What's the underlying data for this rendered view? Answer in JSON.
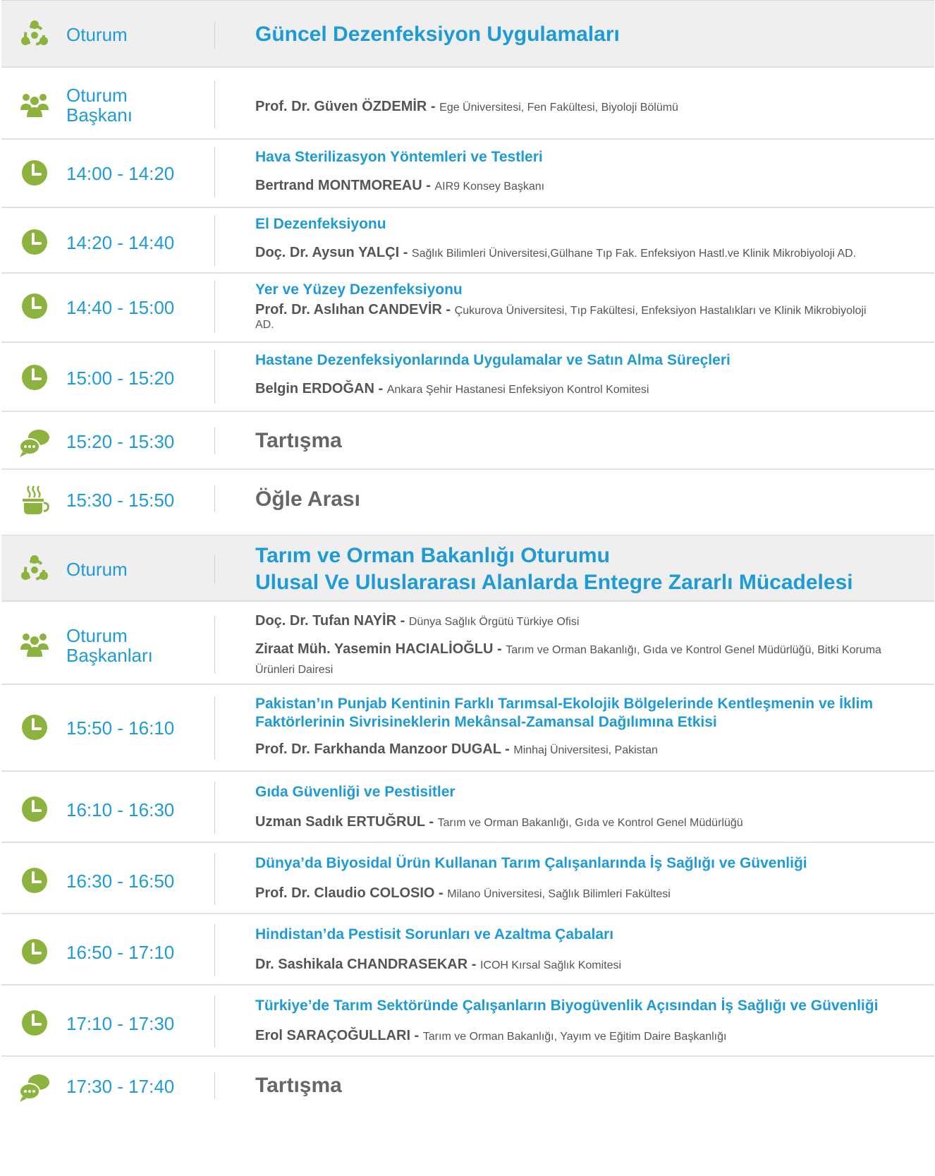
{
  "colors": {
    "accent_blue": "#1e9bd7",
    "icon_green": "#8cb33e",
    "text_gray": "#555555",
    "session_bg": "#efefef"
  },
  "session1": {
    "label": "Oturum",
    "title": "Güncel Dezenfeksiyon Uygulamaları",
    "icon": "session-network-icon"
  },
  "chair1": {
    "label_line1": "Oturum",
    "label_line2": "Başkanı",
    "name": "Prof. Dr. Güven ÖZDEMİR",
    "sep": " - ",
    "aff": "Ege Üniversitesi, Fen Fakültesi, Biyoloji Bölümü",
    "icon": "people-icon"
  },
  "talks1": [
    {
      "time": "14:00 - 14:20",
      "title": "Hava Sterilizasyon Yöntemleri ve Testleri",
      "name": "Bertrand MONTMOREAU",
      "sep": " - ",
      "aff": "AIR9 Konsey Başkanı"
    },
    {
      "time": "14:20 - 14:40",
      "title": "El Dezenfeksiyonu",
      "name": "Doç. Dr. Aysun YALÇI",
      "sep": " - ",
      "aff": "Sağlık Bilimleri Üniversitesi,Gülhane Tıp Fak. Enfeksiyon Hastl.ve Klinik Mikrobiyoloji AD."
    },
    {
      "time": "14:40 - 15:00",
      "title": "Yer ve Yüzey Dezenfeksiyonu",
      "name": "Prof. Dr. Aslıhan CANDEVİR",
      "sep": " - ",
      "aff": "Çukurova Üniversitesi, Tıp Fakültesi, Enfeksiyon Hastalıkları ve Klinik Mikrobiyoloji AD."
    },
    {
      "time": "15:00 - 15:20",
      "title": "Hastane Dezenfeksiyonlarında Uygulamalar ve Satın Alma Süreçleri",
      "name": "Belgin ERDOĞAN",
      "sep": " - ",
      "aff": "Ankara Şehir Hastanesi Enfeksiyon Kontrol Komitesi"
    }
  ],
  "discussion1": {
    "time": "15:20 - 15:30",
    "title": "Tartışma",
    "icon": "chat-bubble-icon"
  },
  "break1": {
    "time": "15:30 - 15:50",
    "title": "Öğle Arası",
    "icon": "coffee-cup-icon"
  },
  "session2": {
    "label": "Oturum",
    "title_line1": "Tarım ve Orman Bakanlığı Oturumu",
    "title_line2": "Ulusal Ve Uluslararası Alanlarda Entegre Zararlı Mücadelesi",
    "icon": "session-network-icon"
  },
  "chair2": {
    "label_line1": "Oturum",
    "label_line2": "Başkanları",
    "chairs": [
      {
        "name": "Doç. Dr. Tufan NAYİR",
        "sep": " - ",
        "aff": "Dünya Sağlık Örgütü Türkiye Ofisi"
      },
      {
        "name": "Ziraat Müh. Yasemin HACIALİOĞLU",
        "sep": "  - ",
        "aff": "Tarım ve Orman Bakanlığı, Gıda ve Kontrol Genel Müdürlüğü, Bitki Koruma Ürünleri Dairesi"
      }
    ],
    "icon": "people-icon"
  },
  "talks2": [
    {
      "time": "15:50 - 16:10",
      "title": "Pakistan’ın Punjab Kentinin Farklı Tarımsal-Ekolojik Bölgelerinde Kentleşmenin ve İklim Faktörlerinin Sivrisineklerin Mekânsal-Zamansal Dağılımına Etkisi",
      "name": "Prof. Dr. Farkhanda Manzoor DUGAL",
      "sep": " - ",
      "aff": "Minhaj Üniversitesi, Pakistan"
    },
    {
      "time": "16:10 - 16:30",
      "title": "Gıda Güvenliği ve Pestisitler",
      "name": "Uzman Sadık ERTUĞRUL",
      "sep": " - ",
      "aff": "Tarım ve Orman Bakanlığı, Gıda ve Kontrol Genel Müdürlüğü"
    },
    {
      "time": "16:30 - 16:50",
      "title": "Dünya’da Biyosidal Ürün Kullanan Tarım Çalışanlarında İş Sağlığı ve Güvenliği",
      "name": "Prof. Dr. Claudio COLOSIO",
      "sep": " - ",
      "aff": "Milano Üniversitesi, Sağlık Bilimleri Fakültesi"
    },
    {
      "time": "16:50 - 17:10",
      "title": "Hindistan’da Pestisit Sorunları ve Azaltma Çabaları",
      "name": "Dr. Sashikala CHANDRASEKAR",
      "sep": " - ",
      "aff": "ICOH Kırsal Sağlık Komitesi"
    },
    {
      "time": "17:10 - 17:30",
      "title": "Türkiye’de Tarım Sektöründe Çalışanların Biyogüvenlik Açısından İş Sağlığı ve Güvenliği",
      "name": "Erol SARAÇOĞULLARI",
      "sep": " - ",
      "aff": "Tarım ve Orman Bakanlığı, Yayım ve Eğitim Daire Başkanlığı"
    }
  ],
  "discussion2": {
    "time": "17:30 - 17:40",
    "title": "Tartışma",
    "icon": "chat-bubble-icon"
  }
}
